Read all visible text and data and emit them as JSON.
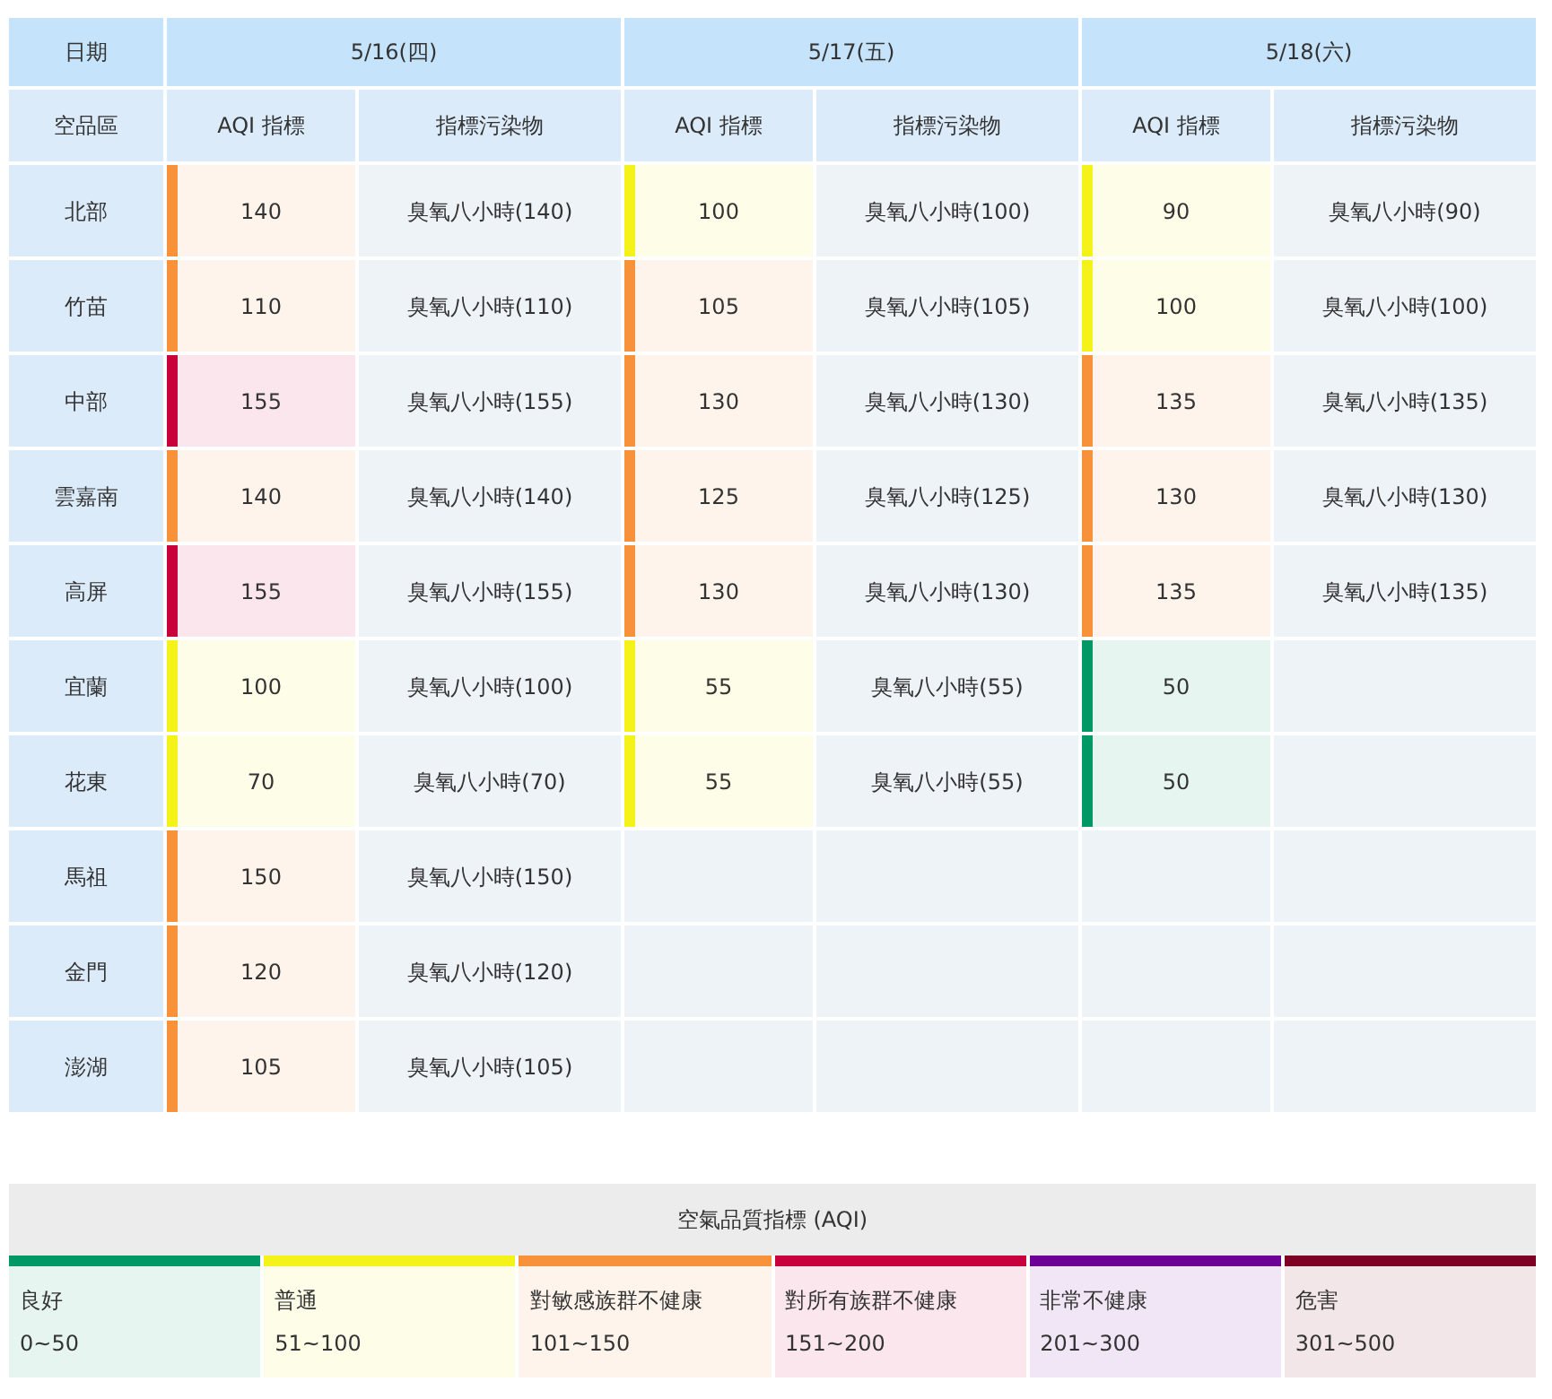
{
  "table": {
    "corner_top": "日期",
    "corner_bottom": "空品區",
    "dates": [
      "5/16(四)",
      "5/17(五)",
      "5/18(六)"
    ],
    "subheaders": [
      [
        "AQI 指標",
        "指標污染物"
      ],
      [
        "AQI 指標",
        "指標污染物"
      ],
      [
        "AQI 指標",
        "指標污染物"
      ]
    ],
    "rows": [
      {
        "region": "北部",
        "days": [
          {
            "aqi": "140",
            "pollutant": "臭氧八小時(140)",
            "color": "#f7923a"
          },
          {
            "aqi": "100",
            "pollutant": "臭氧八小時(100)",
            "color": "#f5f21a"
          },
          {
            "aqi": "90",
            "pollutant": "臭氧八小時(90)",
            "color": "#f5f21a"
          }
        ]
      },
      {
        "region": "竹苗",
        "days": [
          {
            "aqi": "110",
            "pollutant": "臭氧八小時(110)",
            "color": "#f7923a"
          },
          {
            "aqi": "105",
            "pollutant": "臭氧八小時(105)",
            "color": "#f7923a"
          },
          {
            "aqi": "100",
            "pollutant": "臭氧八小時(100)",
            "color": "#f5f21a"
          }
        ]
      },
      {
        "region": "中部",
        "days": [
          {
            "aqi": "155",
            "pollutant": "臭氧八小時(155)",
            "color": "#c8003c"
          },
          {
            "aqi": "130",
            "pollutant": "臭氧八小時(130)",
            "color": "#f7923a"
          },
          {
            "aqi": "135",
            "pollutant": "臭氧八小時(135)",
            "color": "#f7923a"
          }
        ]
      },
      {
        "region": "雲嘉南",
        "days": [
          {
            "aqi": "140",
            "pollutant": "臭氧八小時(140)",
            "color": "#f7923a"
          },
          {
            "aqi": "125",
            "pollutant": "臭氧八小時(125)",
            "color": "#f7923a"
          },
          {
            "aqi": "130",
            "pollutant": "臭氧八小時(130)",
            "color": "#f7923a"
          }
        ]
      },
      {
        "region": "高屏",
        "days": [
          {
            "aqi": "155",
            "pollutant": "臭氧八小時(155)",
            "color": "#c8003c"
          },
          {
            "aqi": "130",
            "pollutant": "臭氧八小時(130)",
            "color": "#f7923a"
          },
          {
            "aqi": "135",
            "pollutant": "臭氧八小時(135)",
            "color": "#f7923a"
          }
        ]
      },
      {
        "region": "宜蘭",
        "days": [
          {
            "aqi": "100",
            "pollutant": "臭氧八小時(100)",
            "color": "#f5f21a"
          },
          {
            "aqi": "55",
            "pollutant": "臭氧八小時(55)",
            "color": "#f5f21a"
          },
          {
            "aqi": "50",
            "color": "#009865"
          }
        ]
      },
      {
        "region": "花東",
        "days": [
          {
            "aqi": "70",
            "pollutant": "臭氧八小時(70)",
            "color": "#f5f21a"
          },
          {
            "aqi": "55",
            "pollutant": "臭氧八小時(55)",
            "color": "#f5f21a"
          },
          {
            "aqi": "50",
            "color": "#009865"
          }
        ]
      },
      {
        "region": "馬祖",
        "days": [
          {
            "aqi": "150",
            "pollutant": "臭氧八小時(150)",
            "color": "#f7923a"
          }
        ]
      },
      {
        "region": "金門",
        "days": [
          {
            "aqi": "120",
            "pollutant": "臭氧八小時(120)",
            "color": "#f7923a"
          }
        ]
      },
      {
        "region": "澎湖",
        "days": [
          {
            "aqi": "105",
            "pollutant": "臭氧八小時(105)",
            "color": "#f7923a"
          }
        ]
      }
    ]
  },
  "legend": {
    "title": "空氣品質指標 (AQI)",
    "levels": [
      {
        "name": "良好",
        "range": "0~50",
        "color": "#009865"
      },
      {
        "name": "普通",
        "range": "51~100",
        "color": "#f5f21a"
      },
      {
        "name": "對敏感族群不健康",
        "range": "101~150",
        "color": "#f7923a"
      },
      {
        "name": "對所有族群不健康",
        "range": "151~200",
        "color": "#c8003c"
      },
      {
        "name": "非常不健康",
        "range": "201~300",
        "color": "#6c0097"
      },
      {
        "name": "危害",
        "range": "301~500",
        "color": "#7e0023"
      }
    ]
  }
}
